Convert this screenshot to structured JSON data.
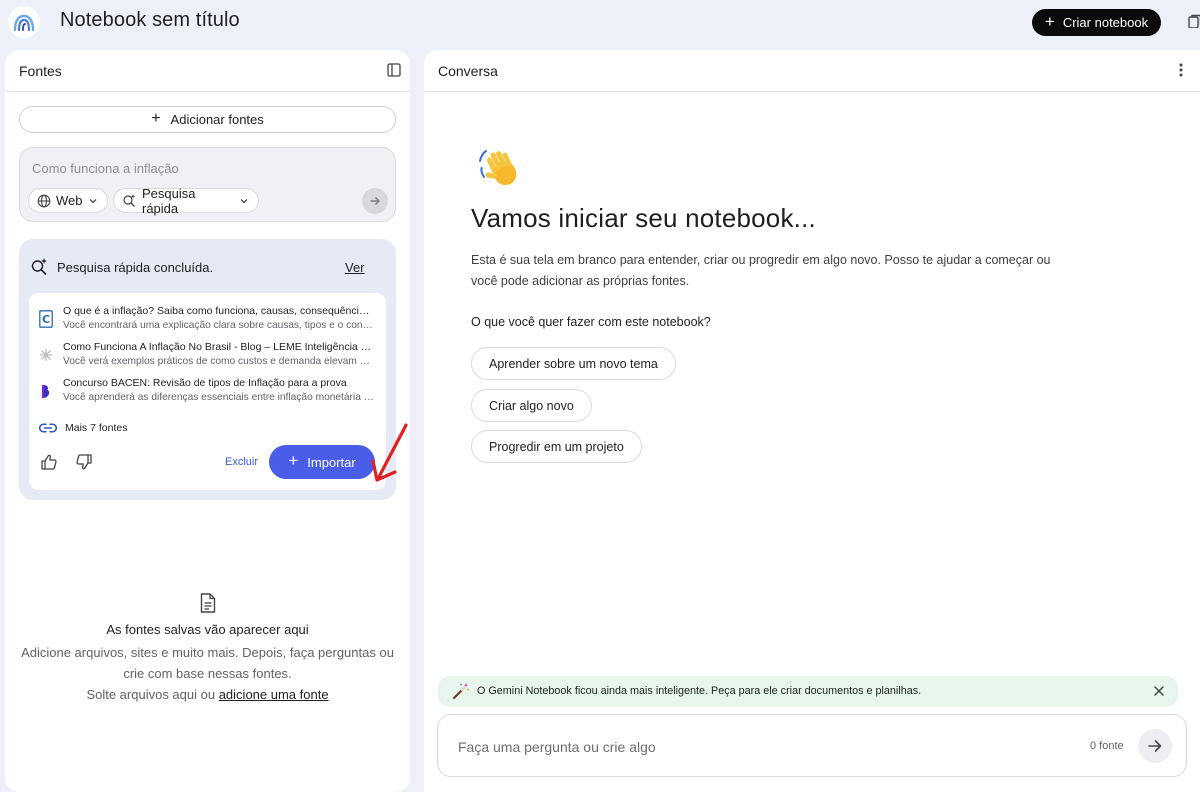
{
  "header": {
    "title": "Notebook sem título",
    "create_button": "Criar notebook"
  },
  "sources_panel": {
    "title": "Fontes",
    "add_button": "Adicionar fontes",
    "search": {
      "placeholder": "Como funciona a inflação",
      "mode": "Web",
      "speed": "Pesquisa rápida"
    },
    "result": {
      "status": "Pesquisa rápida concluída.",
      "view_link": "Ver",
      "sources": [
        {
          "title": "O que é a inflação? Saiba como funciona, causas, consequências e como se proteger",
          "description": "Você encontrará uma explicação clara sobre causas, tipos e o conceito de inflação",
          "icon": "c-logo-icon"
        },
        {
          "title": "Como Funciona A Inflação No Brasil - Blog – LEME Inteligência Financeira",
          "description": "Você verá exemplos práticos de como custos e demanda elevam os preços",
          "icon": "asterisk-icon"
        },
        {
          "title": "Concurso BACEN: Revisão de tipos de Inflação para a prova",
          "description": "Você aprenderá as diferenças essenciais entre inflação monetária e de custos",
          "icon": "b-logo-icon"
        }
      ],
      "more_sources": "Mais 7 fontes",
      "delete_label": "Excluir",
      "import_label": "Importar"
    },
    "empty_state": {
      "title": "As fontes salvas vão aparecer aqui",
      "line1": "Adicione arquivos, sites e muito mais. Depois, faça perguntas ou",
      "line2": "crie com base nessas fontes.",
      "line3_prefix": "Solte arquivos aqui ou ",
      "line3_link": "adicione uma fonte"
    }
  },
  "chat_panel": {
    "title": "Conversa",
    "welcome_title": "Vamos iniciar seu notebook...",
    "welcome_desc": "Esta é sua tela em branco para entender, criar ou progredir em algo novo. Posso te ajudar a começar ou você pode adicionar as próprias fontes.",
    "question": "O que você quer fazer com este notebook?",
    "suggestions": [
      "Aprender sobre um novo tema",
      "Criar algo novo",
      "Progredir em um projeto"
    ],
    "banner": "O Gemini Notebook ficou ainda mais inteligente. Peça para ele criar documentos e planilhas.",
    "input_placeholder": "Faça uma pergunta ou crie algo",
    "source_count": "0 fonte"
  },
  "colors": {
    "background": "#eef0f9",
    "accent": "#4a5de9",
    "result_card": "#e6e9f6",
    "banner": "#e7f6ec",
    "annotation_arrow": "#e02020"
  }
}
